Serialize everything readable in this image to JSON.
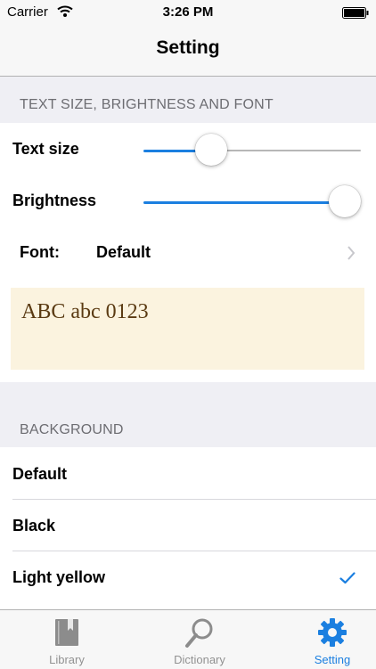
{
  "status": {
    "carrier": "Carrier",
    "time": "3:26 PM"
  },
  "nav": {
    "title": "Setting"
  },
  "text_section": {
    "header": "TEXT SIZE, BRIGHTNESS AND FONT",
    "text_size_label": "Text size",
    "text_size_value": 0.31,
    "brightness_label": "Brightness",
    "brightness_value": 0.93,
    "font_label": "Font:",
    "font_value": "Default",
    "preview_text": "ABC abc 0123"
  },
  "background_section": {
    "header": "BACKGROUND",
    "options": [
      "Default",
      "Black",
      "Light yellow"
    ],
    "selected": "Light yellow"
  },
  "tabs": [
    {
      "label": "Library",
      "icon": "book-icon",
      "active": false
    },
    {
      "label": "Dictionary",
      "icon": "search-icon",
      "active": false
    },
    {
      "label": "Setting",
      "icon": "gear-icon",
      "active": true
    }
  ],
  "colors": {
    "accent": "#1b7fe0",
    "preview_background": "#fbf3df",
    "preview_text": "#5a3a12",
    "grouped_background": "#efeff4"
  }
}
